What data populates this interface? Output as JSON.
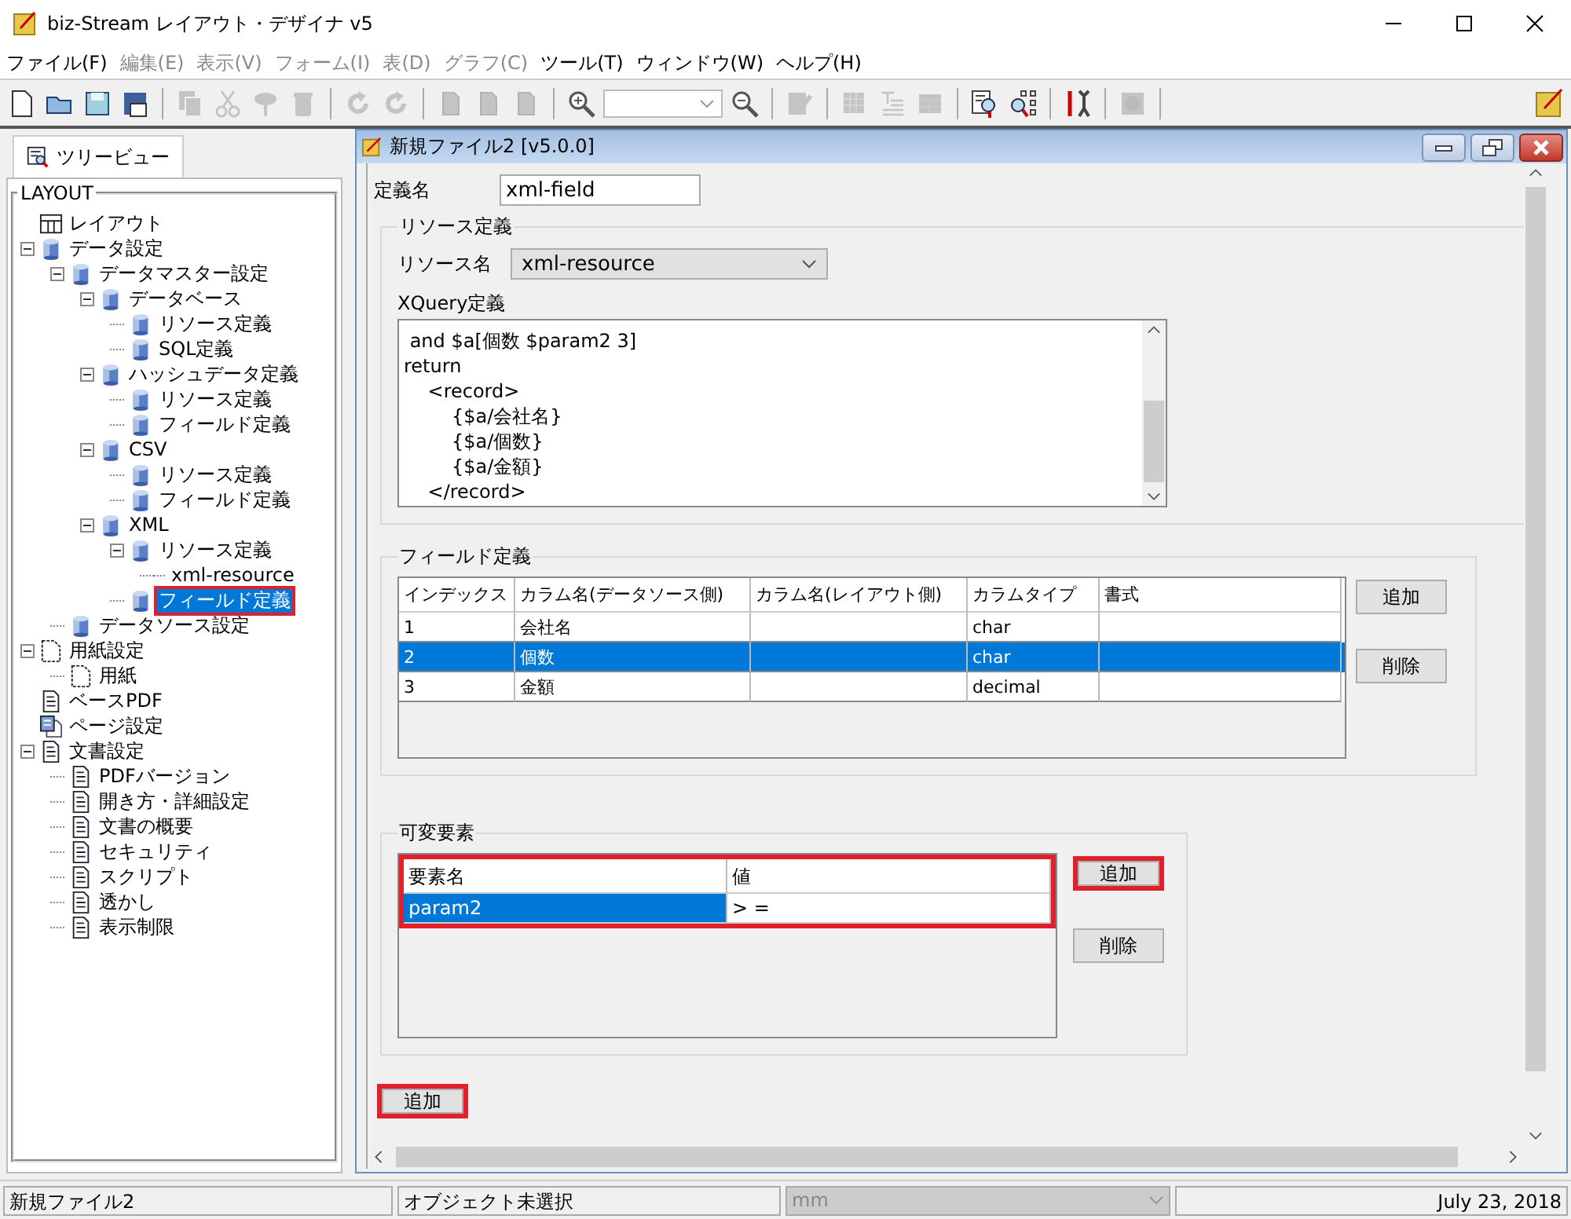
{
  "window": {
    "title": "biz-Stream レイアウト・デザイナ v5"
  },
  "menu": [
    {
      "label": "ファイル(F)",
      "disabled": false
    },
    {
      "label": "編集(E)",
      "disabled": true
    },
    {
      "label": "表示(V)",
      "disabled": true
    },
    {
      "label": "フォーム(I)",
      "disabled": true
    },
    {
      "label": "表(D)",
      "disabled": true
    },
    {
      "label": "グラフ(C)",
      "disabled": true
    },
    {
      "label": "ツール(T)",
      "disabled": false
    },
    {
      "label": "ウィンドウ(W)",
      "disabled": false
    },
    {
      "label": "ヘルプ(H)",
      "disabled": false
    }
  ],
  "toolbar": [
    {
      "kind": "new",
      "disabled": false
    },
    {
      "kind": "open",
      "disabled": false
    },
    {
      "kind": "save",
      "disabled": false
    },
    {
      "kind": "saveas",
      "disabled": false
    },
    {
      "kind": "separator"
    },
    {
      "kind": "copy",
      "disabled": true
    },
    {
      "kind": "cut",
      "disabled": true
    },
    {
      "kind": "pin",
      "disabled": true
    },
    {
      "kind": "trash",
      "disabled": true
    },
    {
      "kind": "separator"
    },
    {
      "kind": "redo",
      "disabled": true
    },
    {
      "kind": "undo",
      "disabled": true
    },
    {
      "kind": "separator"
    },
    {
      "kind": "page",
      "disabled": true
    },
    {
      "kind": "page",
      "disabled": true
    },
    {
      "kind": "page",
      "disabled": true
    },
    {
      "kind": "separator"
    },
    {
      "kind": "zoomin",
      "disabled": false
    },
    {
      "kind": "combo",
      "disabled": false
    },
    {
      "kind": "zoomout",
      "disabled": false
    },
    {
      "kind": "separator"
    },
    {
      "kind": "edit",
      "disabled": true
    },
    {
      "kind": "separator"
    },
    {
      "kind": "grid",
      "disabled": true
    },
    {
      "kind": "text",
      "disabled": true
    },
    {
      "kind": "table",
      "disabled": true
    },
    {
      "kind": "separator"
    },
    {
      "kind": "preview",
      "disabled": false
    },
    {
      "kind": "treesearch",
      "disabled": false
    },
    {
      "kind": "separator"
    },
    {
      "kind": "tools",
      "disabled": false
    },
    {
      "kind": "separator"
    },
    {
      "kind": "stop",
      "disabled": true
    },
    {
      "kind": "separator"
    }
  ],
  "side_tab": {
    "label": "ツリービュー",
    "selected": true
  },
  "tree": {
    "legend": "LAYOUT",
    "items": [
      {
        "label": "レイアウト",
        "kind": "layout",
        "selected": false,
        "highlighted": false
      },
      {
        "label": "データ設定",
        "kind": "db",
        "expanded": true,
        "selected": false,
        "highlighted": false,
        "children": [
          {
            "label": "データマスター設定",
            "kind": "db",
            "expanded": true,
            "selected": false,
            "highlighted": false,
            "children": [
              {
                "label": "データベース",
                "kind": "db",
                "expanded": true,
                "selected": false,
                "highlighted": false,
                "children": [
                  {
                    "label": "リソース定義",
                    "kind": "db",
                    "selected": false,
                    "highlighted": false
                  },
                  {
                    "label": "SQL定義",
                    "kind": "db",
                    "selected": false,
                    "highlighted": false
                  }
                ]
              },
              {
                "label": "ハッシュデータ定義",
                "kind": "db",
                "expanded": true,
                "selected": false,
                "highlighted": false,
                "children": [
                  {
                    "label": "リソース定義",
                    "kind": "db",
                    "selected": false,
                    "highlighted": false
                  },
                  {
                    "label": "フィールド定義",
                    "kind": "db",
                    "selected": false,
                    "highlighted": false
                  }
                ]
              },
              {
                "label": "CSV",
                "kind": "db",
                "expanded": true,
                "selected": false,
                "highlighted": false,
                "children": [
                  {
                    "label": "リソース定義",
                    "kind": "db",
                    "selected": false,
                    "highlighted": false
                  },
                  {
                    "label": "フィールド定義",
                    "kind": "db",
                    "selected": false,
                    "highlighted": false
                  }
                ]
              },
              {
                "label": "XML",
                "kind": "db",
                "expanded": true,
                "selected": false,
                "highlighted": false,
                "children": [
                  {
                    "label": "リソース定義",
                    "kind": "db",
                    "expanded": true,
                    "selected": false,
                    "highlighted": false,
                    "children": [
                      {
                        "label": "xml-resource",
                        "kind": "none",
                        "selected": false,
                        "highlighted": false
                      }
                    ]
                  },
                  {
                    "label": "フィールド定義",
                    "kind": "db",
                    "selected": true,
                    "highlighted": true
                  }
                ]
              }
            ]
          },
          {
            "label": "データソース設定",
            "kind": "db",
            "selected": false,
            "highlighted": false
          }
        ]
      },
      {
        "label": "用紙設定",
        "kind": "paper",
        "expanded": true,
        "selected": false,
        "highlighted": false,
        "children": [
          {
            "label": "用紙",
            "kind": "paper",
            "selected": false,
            "highlighted": false
          }
        ]
      },
      {
        "label": "ベースPDF",
        "kind": "doc",
        "selected": false,
        "highlighted": false
      },
      {
        "label": "ページ設定",
        "kind": "docs",
        "selected": false,
        "highlighted": false
      },
      {
        "label": "文書設定",
        "kind": "doc",
        "expanded": true,
        "selected": false,
        "highlighted": false,
        "children": [
          {
            "label": "PDFバージョン",
            "kind": "doc",
            "selected": false,
            "highlighted": false
          },
          {
            "label": "開き方・詳細設定",
            "kind": "doc",
            "selected": false,
            "highlighted": false
          },
          {
            "label": "文書の概要",
            "kind": "doc",
            "selected": false,
            "highlighted": false
          },
          {
            "label": "セキュリティ",
            "kind": "doc",
            "selected": false,
            "highlighted": false
          },
          {
            "label": "スクリプト",
            "kind": "doc",
            "selected": false,
            "highlighted": false
          },
          {
            "label": "透かし",
            "kind": "doc",
            "selected": false,
            "highlighted": false
          },
          {
            "label": "表示制限",
            "kind": "doc",
            "selected": false,
            "highlighted": false
          }
        ]
      }
    ]
  },
  "document": {
    "title": "新規ファイル2 [v5.0.0]",
    "name_label": "定義名",
    "name_value": "xml-field",
    "resource": {
      "legend": "リソース定義",
      "name_label": "リソース名",
      "name_value": "xml-resource",
      "query_label": "XQuery定義",
      "query_lines": [
        " and $a[個数 $param2 3]",
        "return",
        "    <record>",
        "        {$a/会社名}",
        "        {$a/個数}",
        "        {$a/金額}",
        "    </record>"
      ]
    },
    "fields": {
      "legend": "フィールド定義",
      "columns": [
        "インデックス",
        "カラム名(データソース側)",
        "カラム名(レイアウト側)",
        "カラムタイプ",
        "書式"
      ],
      "rows": [
        {
          "cells": [
            "1",
            "会社名",
            "",
            "char",
            ""
          ],
          "selected": false
        },
        {
          "cells": [
            "2",
            "個数",
            "",
            "char",
            ""
          ],
          "selected": true
        },
        {
          "cells": [
            "3",
            "金額",
            "",
            "decimal",
            ""
          ],
          "selected": false
        }
      ],
      "buttons": [
        {
          "label": "追加",
          "highlighted": false
        },
        {
          "label": "削除",
          "highlighted": false
        }
      ]
    },
    "variables": {
      "legend": "可変要素",
      "highlighted": true,
      "columns": [
        "要素名",
        "値"
      ],
      "rows": [
        {
          "cells": [
            "param2",
            "> ="
          ],
          "selected": true
        }
      ],
      "buttons": [
        {
          "label": "追加",
          "highlighted": true
        },
        {
          "label": "削除",
          "highlighted": false
        }
      ]
    },
    "add_button": {
      "label": "追加",
      "highlighted": true
    }
  },
  "status_bar": {
    "file": "新規ファイル2",
    "object": "オブジェクト未選択",
    "unit": "mm",
    "unit_disabled": true,
    "date": "July 23, 2018"
  }
}
